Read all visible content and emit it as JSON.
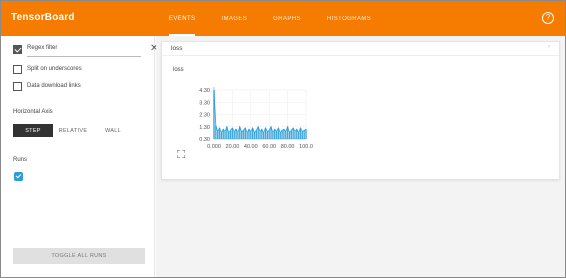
{
  "app": {
    "title": "TensorBoard",
    "tabs": [
      {
        "label": "EVENTS",
        "active": true
      },
      {
        "label": "IMAGES",
        "active": false
      },
      {
        "label": "GRAPHS",
        "active": false
      },
      {
        "label": "HISTOGRAMS",
        "active": false
      }
    ],
    "help_icon": "help-circle-icon"
  },
  "sidebar": {
    "regex": {
      "label": "Regex filter",
      "checked": true,
      "clear_icon": "close-icon"
    },
    "options": [
      {
        "label": "Split on underscores",
        "checked": false
      },
      {
        "label": "Data download links",
        "checked": false
      }
    ],
    "horizontal_axis": {
      "title": "Horizontal Axis",
      "buttons": [
        {
          "label": "STEP",
          "active": true
        },
        {
          "label": "RELATIVE",
          "active": false
        },
        {
          "label": "WALL",
          "active": false
        }
      ]
    },
    "runs": {
      "title": "Runs",
      "swatch_color": "#2b9ed8",
      "checked": true
    },
    "toggle_button": "TOGGLE ALL RUNS"
  },
  "main": {
    "card": {
      "header": "loss",
      "chart_title": "loss",
      "expand_icon": "fullscreen-icon"
    }
  },
  "colors": {
    "accent": "#f57c00",
    "series": "#2b9ed8"
  },
  "chart_data": {
    "type": "line",
    "title": "loss",
    "xlabel": "",
    "ylabel": "",
    "x_ticks": [
      "0.000",
      "20.00",
      "40.00",
      "60.00",
      "80.00",
      "100.0"
    ],
    "y_ticks": [
      "4.30",
      "3.30",
      "2.30",
      "1.30",
      "0.30"
    ],
    "xlim": [
      0,
      100
    ],
    "ylim": [
      0.3,
      4.3
    ],
    "series": [
      {
        "color": "#2b9ed8",
        "x": [
          0,
          2,
          4,
          6,
          8,
          10,
          12,
          14,
          16,
          18,
          20,
          22,
          24,
          26,
          28,
          30,
          32,
          34,
          36,
          38,
          40,
          42,
          44,
          46,
          48,
          50,
          52,
          54,
          56,
          58,
          60,
          62,
          64,
          66,
          68,
          70,
          72,
          74,
          76,
          78,
          80,
          82,
          84,
          86,
          88,
          90,
          92,
          94,
          96,
          98,
          100
        ],
        "y": [
          4.3,
          1.4,
          0.9,
          1.2,
          0.8,
          1.1,
          0.9,
          1.3,
          0.8,
          1.0,
          1.2,
          0.9,
          1.1,
          0.8,
          1.3,
          0.9,
          1.0,
          1.2,
          0.8,
          1.1,
          0.9,
          1.2,
          0.8,
          1.0,
          1.3,
          0.9,
          1.1,
          0.8,
          1.2,
          0.9,
          1.0,
          1.3,
          0.8,
          1.1,
          0.9,
          1.2,
          0.8,
          1.0,
          1.1,
          0.9,
          1.3,
          0.8,
          1.0,
          1.2,
          0.9,
          1.1,
          0.8,
          1.2,
          0.9,
          1.0,
          1.1
        ]
      }
    ],
    "grid": true
  }
}
